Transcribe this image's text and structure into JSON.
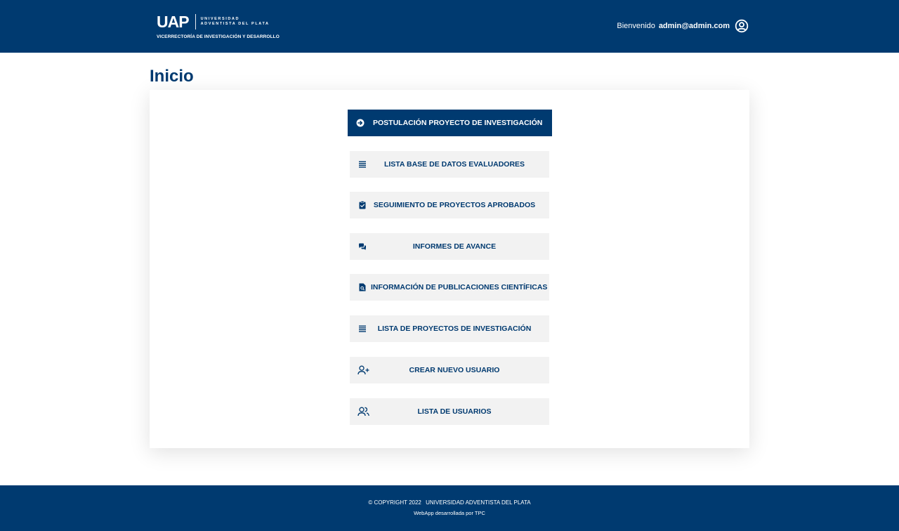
{
  "header": {
    "logo_text": "UAP",
    "university_line1": "UNIVERSIDAD",
    "university_line2": "ADVENTISTA DEL PLATA",
    "subtitle": "VICERRECTORÍA DE INVESTIGACIÓN Y DESARROLLO",
    "welcome": "Bienvenido",
    "user_email": "admin@admin.com"
  },
  "page": {
    "title": "Inicio"
  },
  "menu": [
    {
      "label": "POSTULACIÓN PROYECTO DE INVESTIGACIÓN",
      "icon": "arrow-circle-right-icon"
    },
    {
      "label": "LISTA BASE DE DATOS EVALUADORES",
      "icon": "list-icon"
    },
    {
      "label": "SEGUIMIENTO DE PROYECTOS APROBADOS",
      "icon": "clipboard-check-icon"
    },
    {
      "label": "INFORMES DE AVANCE",
      "icon": "comments-icon"
    },
    {
      "label": "INFORMACIÓN DE PUBLICACIONES CIENTÍFICAS",
      "icon": "file-search-icon"
    },
    {
      "label": "LISTA DE PROYECTOS DE INVESTIGACIÓN",
      "icon": "list-icon"
    },
    {
      "label": "CREAR NUEVO USUARIO",
      "icon": "user-plus-icon"
    },
    {
      "label": "LISTA DE USUARIOS",
      "icon": "users-icon"
    }
  ],
  "footer": {
    "copyright": "© COPYRIGHT 2022",
    "institution": "UNIVERSIDAD ADVENTISTA DEL PLATA",
    "developer": "WebApp desarrollada por TPC"
  },
  "colors": {
    "brand": "#003a70",
    "button_bg": "#f2f2f2",
    "white": "#ffffff"
  }
}
